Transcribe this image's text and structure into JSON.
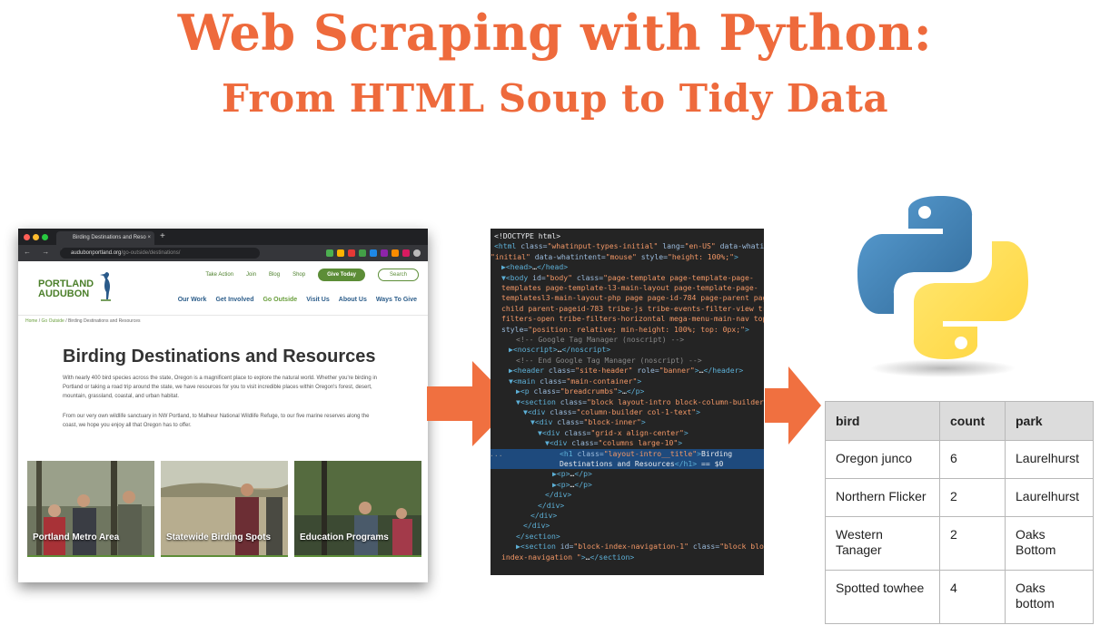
{
  "title": {
    "line1": "Web Scraping with Python:",
    "line2": "From HTML Soup to Tidy Data"
  },
  "browser": {
    "tab_title": "Birding Destinations and Reso",
    "tab_close": "×",
    "new_tab": "+",
    "nav_buttons": "← → C",
    "url_domain": "audubonportland.org",
    "url_path": "/go-outside/destinations/",
    "site": {
      "logo_line1": "PORTLAND",
      "logo_line2": "AUDUBON",
      "util_nav": [
        "Take Action",
        "Join",
        "Blog",
        "Shop"
      ],
      "give_button": "Give Today",
      "search_button": "Search",
      "main_nav": [
        "Our Work",
        "Get Involved",
        "Go Outside",
        "Visit Us",
        "About Us",
        "Ways To Give"
      ],
      "breadcrumb": [
        "Home",
        "Go Outside",
        "Birding Destinations and Resources"
      ],
      "heading": "Birding Destinations and Resources",
      "paragraph1": "With nearly 400 bird species across the state, Oregon is a magnificent place to explore the natural world. Whether you're birding in Portland or taking a road trip around the state, we have resources for you to visit incredible places within Oregon's forest, desert, mountain, grassland, coastal, and urban habitat.",
      "paragraph2": "From our very own wildlife sanctuary in NW Portland, to Malheur National Wildlife Refuge, to our five marine reserves along the coast, we hope you enjoy all that Oregon has to offer.",
      "cards": [
        "Portland Metro Area",
        "Statewide Birding Spots",
        "Education Programs"
      ]
    }
  },
  "code": {
    "lines": [
      {
        "t": "txt",
        "s": "<!DOCTYPE html>",
        "i": 0
      },
      {
        "t": "raw",
        "parts": [
          [
            "tag",
            "<html "
          ],
          [
            "attr",
            "class="
          ],
          [
            "val",
            "\"whatinput-types-initial\""
          ],
          [
            "attr",
            " lang="
          ],
          [
            "val",
            "\"en-US\""
          ],
          [
            "attr",
            " data-whatinput="
          ]
        ],
        "i": 0
      },
      {
        "t": "raw",
        "parts": [
          [
            "val",
            "\"initial\""
          ],
          [
            "attr",
            " data-whatintent="
          ],
          [
            "val",
            "\"mouse\""
          ],
          [
            "attr",
            " style="
          ],
          [
            "val",
            "\"height: 100%;\""
          ],
          [
            "tag",
            ">"
          ]
        ],
        "i": -1
      },
      {
        "t": "raw",
        "parts": [
          [
            "tag",
            "▶<head>"
          ],
          [
            "txt",
            "…"
          ],
          [
            "tag",
            "</head>"
          ]
        ],
        "i": 1
      },
      {
        "t": "raw",
        "parts": [
          [
            "tag",
            "▼<body "
          ],
          [
            "attr",
            "id="
          ],
          [
            "val",
            "\"body\""
          ],
          [
            "attr",
            " class="
          ],
          [
            "val",
            "\"page-template page-template-page-"
          ]
        ],
        "i": 1
      },
      {
        "t": "raw",
        "parts": [
          [
            "val",
            "templates page-template-l3-main-layout page-template-page-"
          ]
        ],
        "i": 1
      },
      {
        "t": "raw",
        "parts": [
          [
            "val",
            "templatesl3-main-layout-php page page-id-784 page-parent page-"
          ]
        ],
        "i": 1
      },
      {
        "t": "raw",
        "parts": [
          [
            "val",
            "child parent-pageid-783 tribe-js tribe-events-filter-view tribe-"
          ]
        ],
        "i": 1
      },
      {
        "t": "raw",
        "parts": [
          [
            "val",
            "filters-open tribe-filters-horizontal mega-menu-main-nav topbar\""
          ]
        ],
        "i": 1
      },
      {
        "t": "raw",
        "parts": [
          [
            "attr",
            "style="
          ],
          [
            "val",
            "\"position: relative; min-height: 100%; top: 0px;\""
          ],
          [
            "tag",
            ">"
          ]
        ],
        "i": 1
      },
      {
        "t": "raw",
        "parts": [
          [
            "cmt",
            "<!-- Google Tag Manager (noscript) -->"
          ]
        ],
        "i": 3
      },
      {
        "t": "raw",
        "parts": [
          [
            "tag",
            "▶<noscript>"
          ],
          [
            "txt",
            "…"
          ],
          [
            "tag",
            "</noscript>"
          ]
        ],
        "i": 2
      },
      {
        "t": "raw",
        "parts": [
          [
            "cmt",
            "<!-- End Google Tag Manager (noscript) -->"
          ]
        ],
        "i": 3
      },
      {
        "t": "raw",
        "parts": [
          [
            "tag",
            "▶<header "
          ],
          [
            "attr",
            "class="
          ],
          [
            "val",
            "\"site-header\""
          ],
          [
            "attr",
            " role="
          ],
          [
            "val",
            "\"banner\""
          ],
          [
            "tag",
            ">"
          ],
          [
            "txt",
            "…"
          ],
          [
            "tag",
            "</header>"
          ]
        ],
        "i": 2
      },
      {
        "t": "raw",
        "parts": [
          [
            "tag",
            "▼<main "
          ],
          [
            "attr",
            "class="
          ],
          [
            "val",
            "\"main-container\""
          ],
          [
            "tag",
            ">"
          ]
        ],
        "i": 2
      },
      {
        "t": "raw",
        "parts": [
          [
            "tag",
            "▶<p "
          ],
          [
            "attr",
            "class="
          ],
          [
            "val",
            "\"breadcrumbs\""
          ],
          [
            "tag",
            ">"
          ],
          [
            "txt",
            "…"
          ],
          [
            "tag",
            "</p>"
          ]
        ],
        "i": 3
      },
      {
        "t": "raw",
        "parts": [
          [
            "tag",
            "▼<section "
          ],
          [
            "attr",
            "class="
          ],
          [
            "val",
            "\"block layout-intro block-column-builder\""
          ],
          [
            "tag",
            ">"
          ]
        ],
        "i": 3
      },
      {
        "t": "raw",
        "parts": [
          [
            "tag",
            "▼<div "
          ],
          [
            "attr",
            "class="
          ],
          [
            "val",
            "\"column-builder col-1-text\""
          ],
          [
            "tag",
            ">"
          ]
        ],
        "i": 4
      },
      {
        "t": "raw",
        "parts": [
          [
            "tag",
            "▼<div "
          ],
          [
            "attr",
            "class="
          ],
          [
            "val",
            "\"block-inner\""
          ],
          [
            "tag",
            ">"
          ]
        ],
        "i": 5
      },
      {
        "t": "raw",
        "parts": [
          [
            "tag",
            "▼<div "
          ],
          [
            "attr",
            "class="
          ],
          [
            "val",
            "\"grid-x align-center\""
          ],
          [
            "tag",
            ">"
          ]
        ],
        "i": 6
      },
      {
        "t": "raw",
        "parts": [
          [
            "tag",
            "▼<div "
          ],
          [
            "attr",
            "class="
          ],
          [
            "val",
            "\"columns large-10\""
          ],
          [
            "tag",
            ">"
          ]
        ],
        "i": 7
      },
      {
        "t": "sel",
        "parts": [
          [
            "tag",
            "<h1 "
          ],
          [
            "attr",
            "class="
          ],
          [
            "val",
            "\"layout-intro__title\""
          ],
          [
            "tag",
            ">"
          ],
          [
            "txt",
            "Birding"
          ]
        ],
        "i": 9
      },
      {
        "t": "sel",
        "parts": [
          [
            "txt",
            "Destinations and Resources"
          ],
          [
            "tag",
            "</h1>"
          ],
          [
            "txt",
            " == $0"
          ]
        ],
        "i": 9
      },
      {
        "t": "raw",
        "parts": [
          [
            "tag",
            "▶<p>"
          ],
          [
            "txt",
            "…"
          ],
          [
            "tag",
            "</p>"
          ]
        ],
        "i": 8
      },
      {
        "t": "raw",
        "parts": [
          [
            "tag",
            "▶<p>"
          ],
          [
            "txt",
            "…"
          ],
          [
            "tag",
            "</p>"
          ]
        ],
        "i": 8
      },
      {
        "t": "raw",
        "parts": [
          [
            "tag",
            "</div>"
          ]
        ],
        "i": 7
      },
      {
        "t": "raw",
        "parts": [
          [
            "tag",
            "</div>"
          ]
        ],
        "i": 6
      },
      {
        "t": "raw",
        "parts": [
          [
            "tag",
            "</div>"
          ]
        ],
        "i": 5
      },
      {
        "t": "raw",
        "parts": [
          [
            "tag",
            "</div>"
          ]
        ],
        "i": 4
      },
      {
        "t": "raw",
        "parts": [
          [
            "tag",
            "</section>"
          ]
        ],
        "i": 3
      },
      {
        "t": "raw",
        "parts": [
          [
            "tag",
            "▶<section "
          ],
          [
            "attr",
            "id="
          ],
          [
            "val",
            "\"block-index-navigation-1\""
          ],
          [
            "attr",
            " class="
          ],
          [
            "val",
            "\"block block-"
          ]
        ],
        "i": 3
      },
      {
        "t": "raw",
        "parts": [
          [
            "val",
            "index-navigation \""
          ],
          [
            "tag",
            ">"
          ],
          [
            "txt",
            "…"
          ],
          [
            "tag",
            "</section>"
          ]
        ],
        "i": 1
      }
    ],
    "gutter_dots": "..."
  },
  "table": {
    "headers": [
      "bird",
      "count",
      "park"
    ],
    "rows": [
      [
        "Oregon junco",
        "6",
        "Laurelhurst"
      ],
      [
        "Northern Flicker",
        "2",
        "Laurelhurst"
      ],
      [
        "Western Tanager",
        "2",
        "Oaks Bottom"
      ],
      [
        "Spotted towhee",
        "4",
        "Oaks bottom"
      ]
    ]
  },
  "colors": {
    "title_orange": "#ee6a3c",
    "arrow_orange": "#f07040",
    "audubon_green": "#5c8d37",
    "code_background": "#242424"
  },
  "icons": [
    "python-logo",
    "arrow-right-icon",
    "heron-logo-icon"
  ]
}
